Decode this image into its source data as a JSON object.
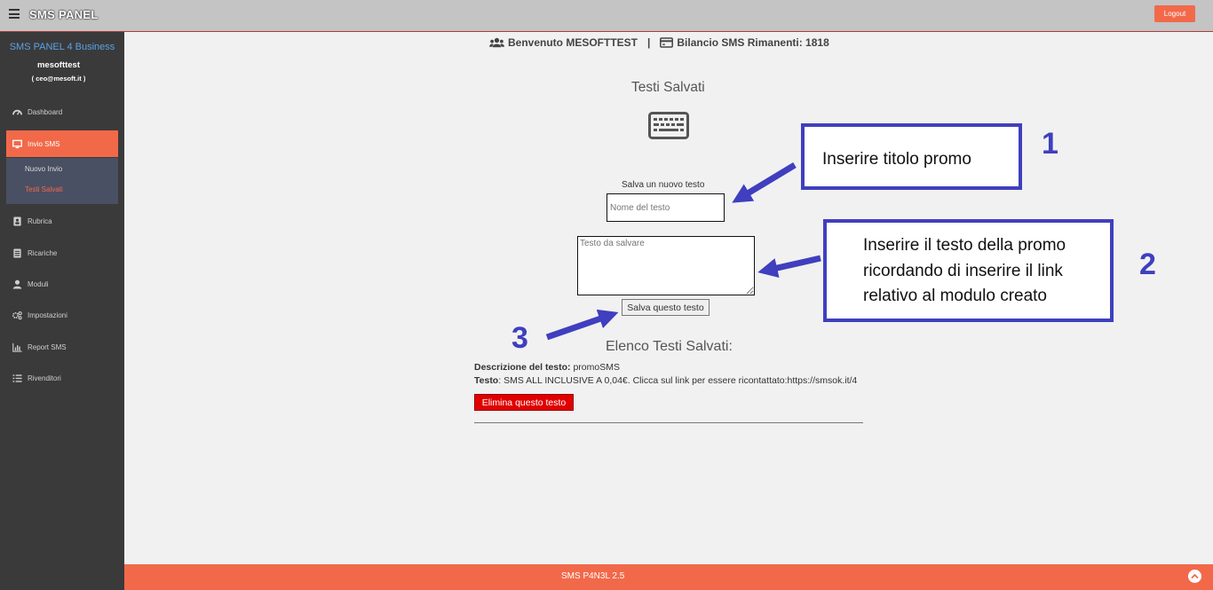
{
  "topbar": {
    "brand": "SMS PANEL",
    "logout_label": "Logout"
  },
  "sidebar": {
    "title": "SMS PANEL 4 Business",
    "username": "mesofttest",
    "email": "( ceo@mesoft.it )",
    "items": [
      {
        "label": "Dashboard",
        "icon": "dashboard-icon"
      },
      {
        "label": "Invio SMS",
        "icon": "monitor-icon"
      },
      {
        "label": "Rubrica",
        "icon": "contact-book-icon"
      },
      {
        "label": "Ricariche",
        "icon": "receipt-icon"
      },
      {
        "label": "Moduli",
        "icon": "user-icon"
      },
      {
        "label": "Impostazioni",
        "icon": "gears-icon"
      },
      {
        "label": "Report SMS",
        "icon": "bar-chart-icon"
      },
      {
        "label": "Rivenditori",
        "icon": "list-icon"
      }
    ],
    "submenu": [
      "Nuovo Invio",
      "Testi Salvati"
    ]
  },
  "header": {
    "welcome": "Benvenuto MESOFTTEST",
    "separator": "|",
    "balance": "Bilancio SMS Rimanenti: 1818"
  },
  "main": {
    "section_title": "Testi Salvati",
    "new_text_label": "Salva un nuovo testo",
    "name_placeholder": "Nome del testo",
    "text_placeholder": "Testo da salvare",
    "save_button": "Salva questo testo",
    "list_title": "Elenco Testi Salvati:",
    "saved_item": {
      "desc_label": "Descrizione del testo:",
      "desc_value": " promoSMS",
      "text_label": "Testo",
      "text_value": ": SMS ALL INCLUSIVE A 0,04€. Clicca sul link per essere ricontattato:https://smsok.it/4",
      "delete_button": "Elimina questo testo"
    }
  },
  "annotations": {
    "callout1": "Inserire titolo promo",
    "callout2": "Inserire il testo della promo ricordando di inserire il link relativo al modulo creato",
    "num1": "1",
    "num2": "2",
    "num3": "3",
    "color": "#3f3fbf"
  },
  "footer": {
    "text": "SMS P4N3L 2.5"
  },
  "colors": {
    "accent": "#f2694a",
    "sidebar": "#3a3a3a",
    "submenu": "#4a5063",
    "delete": "#e00000"
  }
}
